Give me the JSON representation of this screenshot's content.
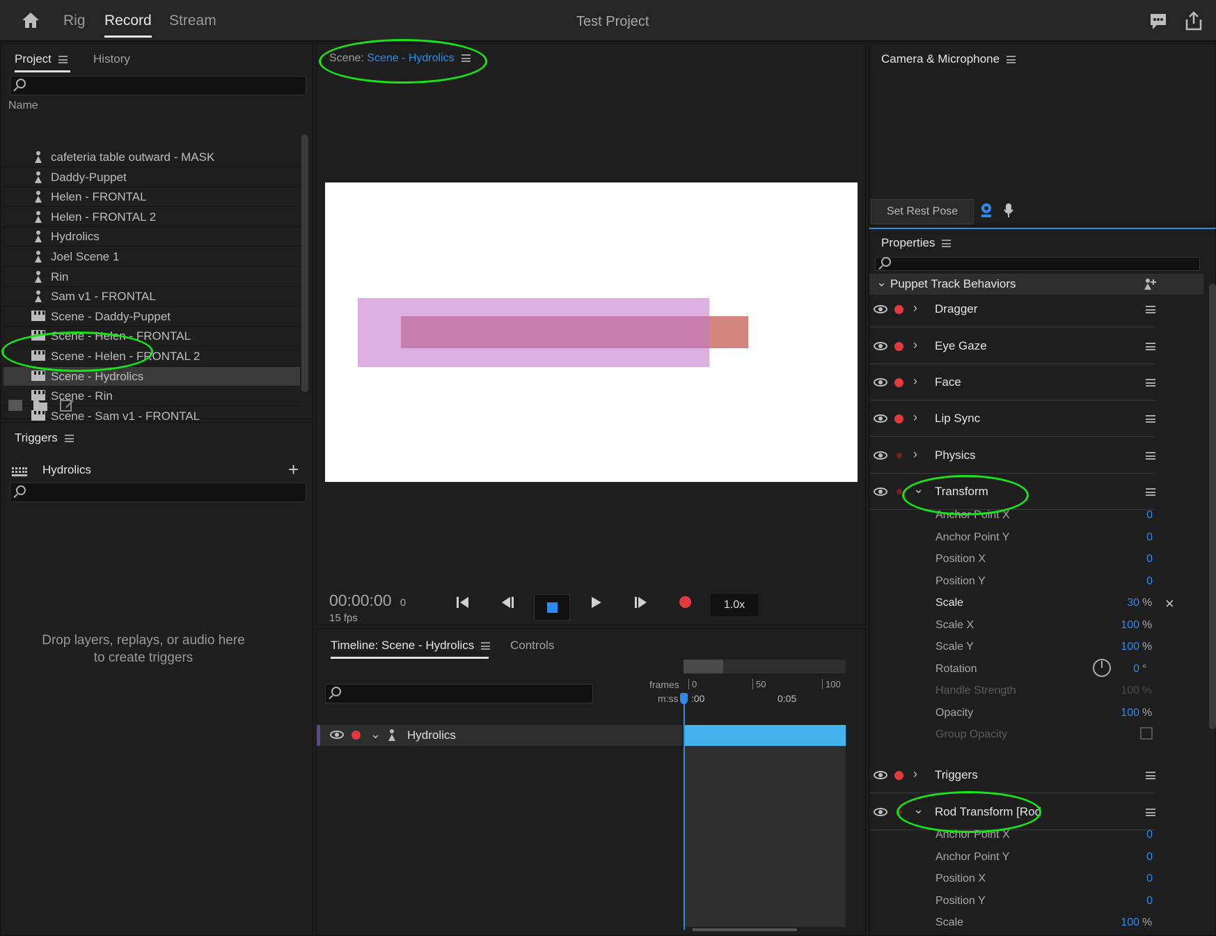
{
  "app": {
    "title": "Test Project",
    "nav": [
      "Rig",
      "Record",
      "Stream"
    ]
  },
  "project_panel": {
    "tabs": [
      "Project",
      "History"
    ],
    "column_name": "Name",
    "items": [
      {
        "name": "cafeteria table outward - MASK",
        "type": "puppet"
      },
      {
        "name": "Daddy-Puppet",
        "type": "puppet"
      },
      {
        "name": "Helen - FRONTAL",
        "type": "puppet"
      },
      {
        "name": "Helen - FRONTAL 2",
        "type": "puppet"
      },
      {
        "name": "Hydrolics",
        "type": "puppet"
      },
      {
        "name": "Joel Scene 1",
        "type": "puppet"
      },
      {
        "name": "Rin",
        "type": "puppet"
      },
      {
        "name": "Sam v1 - FRONTAL",
        "type": "puppet"
      },
      {
        "name": "Scene - Daddy-Puppet",
        "type": "scene"
      },
      {
        "name": "Scene - Helen - FRONTAL",
        "type": "scene"
      },
      {
        "name": "Scene - Helen - FRONTAL 2",
        "type": "scene"
      },
      {
        "name": "Scene - Hydrolics",
        "type": "scene",
        "selected": true
      },
      {
        "name": "Scene - Rin",
        "type": "scene"
      },
      {
        "name": "Scene - Sam v1 - FRONTAL",
        "type": "scene"
      }
    ]
  },
  "triggers_panel": {
    "title": "Triggers",
    "item": "Hydrolics",
    "empty_line1": "Drop layers, replays, or audio here",
    "empty_line2": "to create triggers"
  },
  "scene_panel": {
    "prefix": "Scene:",
    "name": "Scene - Hydrolics",
    "timecode": "00:00:00",
    "frame": "0",
    "fps": "15 fps",
    "speed": "1.0x"
  },
  "timeline": {
    "tab": "Timeline: Scene - Hydrolics",
    "tab2": "Controls",
    "frames_label": "frames",
    "mss_label": "m:ss",
    "ruler": [
      "0",
      "50",
      "100"
    ],
    "ruler_time": [
      ":00",
      "0:05"
    ],
    "track": "Hydrolics"
  },
  "camera_panel": {
    "title": "Camera & Microphone",
    "rest_pose": "Set Rest Pose"
  },
  "properties": {
    "title": "Properties",
    "group": "Puppet Track Behaviors",
    "behaviors": [
      "Dragger",
      "Eye Gaze",
      "Face",
      "Lip Sync",
      "Physics"
    ],
    "transform": {
      "name": "Transform",
      "params": [
        {
          "label": "Anchor Point X",
          "value": "0",
          "unit": ""
        },
        {
          "label": "Anchor Point Y",
          "value": "0",
          "unit": ""
        },
        {
          "label": "Position X",
          "value": "0",
          "unit": ""
        },
        {
          "label": "Position Y",
          "value": "0",
          "unit": ""
        },
        {
          "label": "Scale",
          "value": "30",
          "unit": "%"
        },
        {
          "label": "Scale X",
          "value": "100",
          "unit": "%"
        },
        {
          "label": "Scale Y",
          "value": "100",
          "unit": "%"
        },
        {
          "label": "Rotation",
          "value": "0",
          "unit": "°"
        },
        {
          "label": "Handle Strength",
          "value": "100",
          "unit": "%"
        },
        {
          "label": "Opacity",
          "value": "100",
          "unit": "%"
        },
        {
          "label": "Group Opacity",
          "value": "",
          "unit": ""
        }
      ]
    },
    "triggers_beh": "Triggers",
    "rod": {
      "name": "Rod Transform [Rod",
      "params": [
        {
          "label": "Anchor Point X",
          "value": "0",
          "unit": ""
        },
        {
          "label": "Anchor Point Y",
          "value": "0",
          "unit": ""
        },
        {
          "label": "Position X",
          "value": "0",
          "unit": ""
        },
        {
          "label": "Position Y",
          "value": "0",
          "unit": ""
        },
        {
          "label": "Scale",
          "value": "100",
          "unit": "%"
        }
      ]
    }
  },
  "colors": {
    "accent": "#2d8ceb",
    "record": "#e0393e",
    "highlight": "#16e616",
    "clip": "#45b4ec"
  }
}
